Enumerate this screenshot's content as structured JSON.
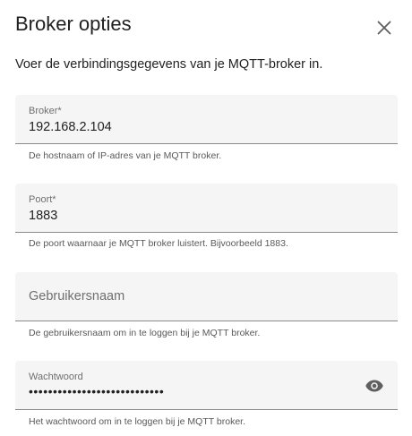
{
  "dialog": {
    "title": "Broker opties",
    "description": "Voer de verbindingsgegevens van je MQTT-broker in.",
    "close_icon": "close-icon"
  },
  "fields": {
    "broker": {
      "label": "Broker*",
      "value": "192.168.2.104",
      "helper": "De hostnaam of IP-adres van je MQTT broker."
    },
    "port": {
      "label": "Poort*",
      "value": "1883",
      "helper": "De poort waarnaar je MQTT broker luistert. Bijvoorbeeld 1883."
    },
    "username": {
      "placeholder": "Gebruikersnaam",
      "value": "",
      "helper": "De gebruikersnaam om in te loggen bij je MQTT broker."
    },
    "password": {
      "label": "Wachtwoord",
      "masked_value": "••••••••••••••••••••••••••••",
      "helper": "Het wachtwoord om in te loggen bij je MQTT broker.",
      "toggle_icon": "eye-icon"
    }
  },
  "colors": {
    "field_background": "#f5f5f5",
    "underline": "#8a8a8a",
    "text": "#212121",
    "secondary_text": "#6f6f6f"
  }
}
